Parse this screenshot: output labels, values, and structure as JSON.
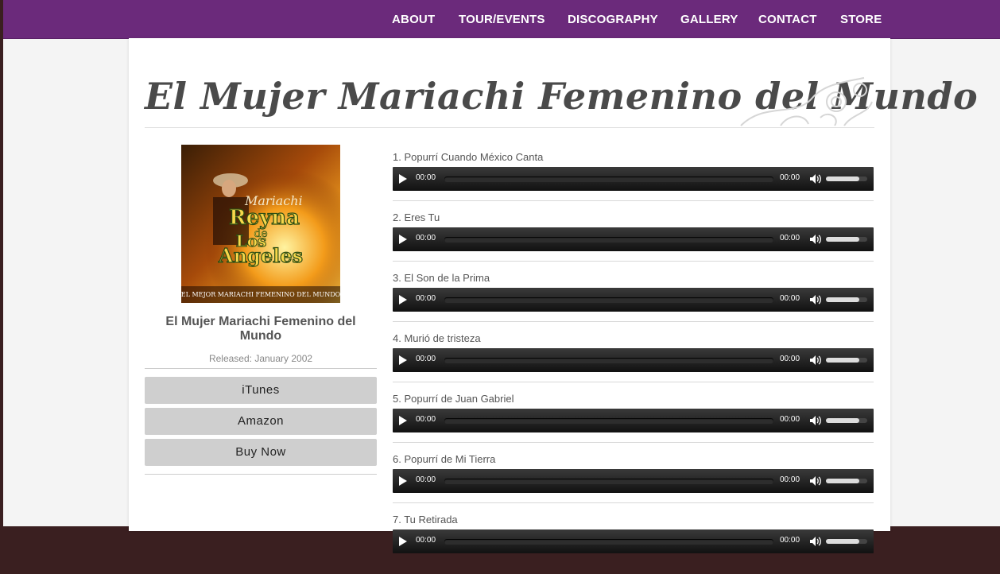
{
  "nav": {
    "items": [
      {
        "label": "ABOUT"
      },
      {
        "label": "TOUR/EVENTS"
      },
      {
        "label": "DISCOGRAPHY"
      },
      {
        "label": "GALLERY"
      },
      {
        "label": "CONTACT"
      },
      {
        "label": "STORE"
      }
    ]
  },
  "page": {
    "title": "El Mujer Mariachi Femenino del Mundo"
  },
  "album": {
    "cover": {
      "script_text": "Mariachi",
      "name_lines": [
        "Reyna",
        "de",
        "Los",
        "Angeles"
      ],
      "caption": "EL MEJOR MARIACHI  FEMENINO DEL MUNDO"
    },
    "name": "El Mujer Mariachi Femenino del Mundo",
    "released": "Released: January 2002",
    "buy_buttons": [
      {
        "label": "iTunes"
      },
      {
        "label": "Amazon"
      },
      {
        "label": "Buy Now"
      }
    ]
  },
  "tracks": [
    {
      "title": "1. Popurrí Cuando México Canta",
      "current": "00:00",
      "duration": "00:00"
    },
    {
      "title": "2. Eres Tu",
      "current": "00:00",
      "duration": "00:00"
    },
    {
      "title": "3. El Son de la Prima",
      "current": "00:00",
      "duration": "00:00"
    },
    {
      "title": "4. Murió de tristeza",
      "current": "00:00",
      "duration": "00:00"
    },
    {
      "title": "5. Popurrí de Juan Gabriel",
      "current": "00:00",
      "duration": "00:00"
    },
    {
      "title": "6. Popurrí de Mi Tierra",
      "current": "00:00",
      "duration": "00:00"
    },
    {
      "title": "7. Tu Retirada",
      "current": "00:00",
      "duration": "00:00"
    }
  ],
  "player": {
    "volume_level": 0.8
  },
  "colors": {
    "nav_bg": "#6b2a7b",
    "button_bg": "#cfcfcf",
    "player_bg": "#1a1a1a"
  }
}
